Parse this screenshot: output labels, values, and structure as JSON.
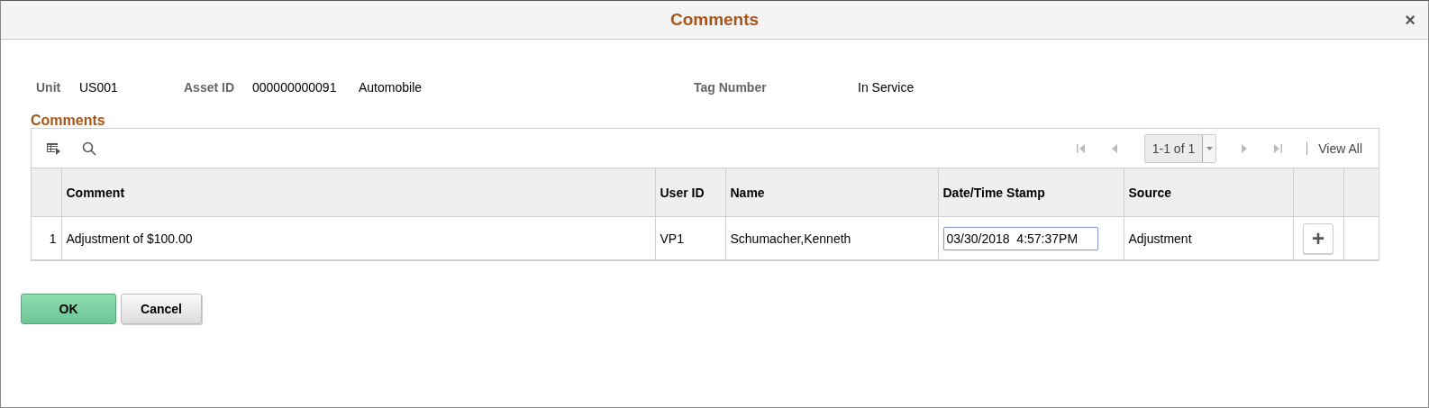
{
  "window": {
    "title": "Comments",
    "close": "×"
  },
  "header_fields": [
    {
      "label": "Unit",
      "value": "US001"
    },
    {
      "label": "Asset ID",
      "value": "000000000091",
      "extra": "Automobile"
    },
    {
      "label": "Tag Number",
      "value": "In Service"
    }
  ],
  "section_title": "Comments",
  "grid": {
    "pager": {
      "range": "1-1 of 1",
      "view_all": "View All",
      "nav": [
        {
          "kind": "first",
          "disabled": true
        },
        {
          "kind": "prev",
          "disabled": true
        },
        {
          "kind": "next",
          "disabled": true
        },
        {
          "kind": "last",
          "disabled": true
        }
      ]
    },
    "columns": [
      "Comment",
      "User ID",
      "Name",
      "Date/Time Stamp",
      "Source"
    ],
    "rows": [
      {
        "number": "1",
        "comment": "Adjustment of $100.00",
        "user_id": "VP1",
        "name": "Schumacher,Kenneth",
        "date_time": {
          "value": "03/30/2018  4:57:37PM",
          "focused": true
        },
        "source": "Adjustment",
        "add": "+"
      }
    ]
  },
  "buttons": [
    {
      "label": "OK",
      "kind": "primary"
    },
    {
      "label": "Cancel",
      "kind": "secondary"
    }
  ]
}
